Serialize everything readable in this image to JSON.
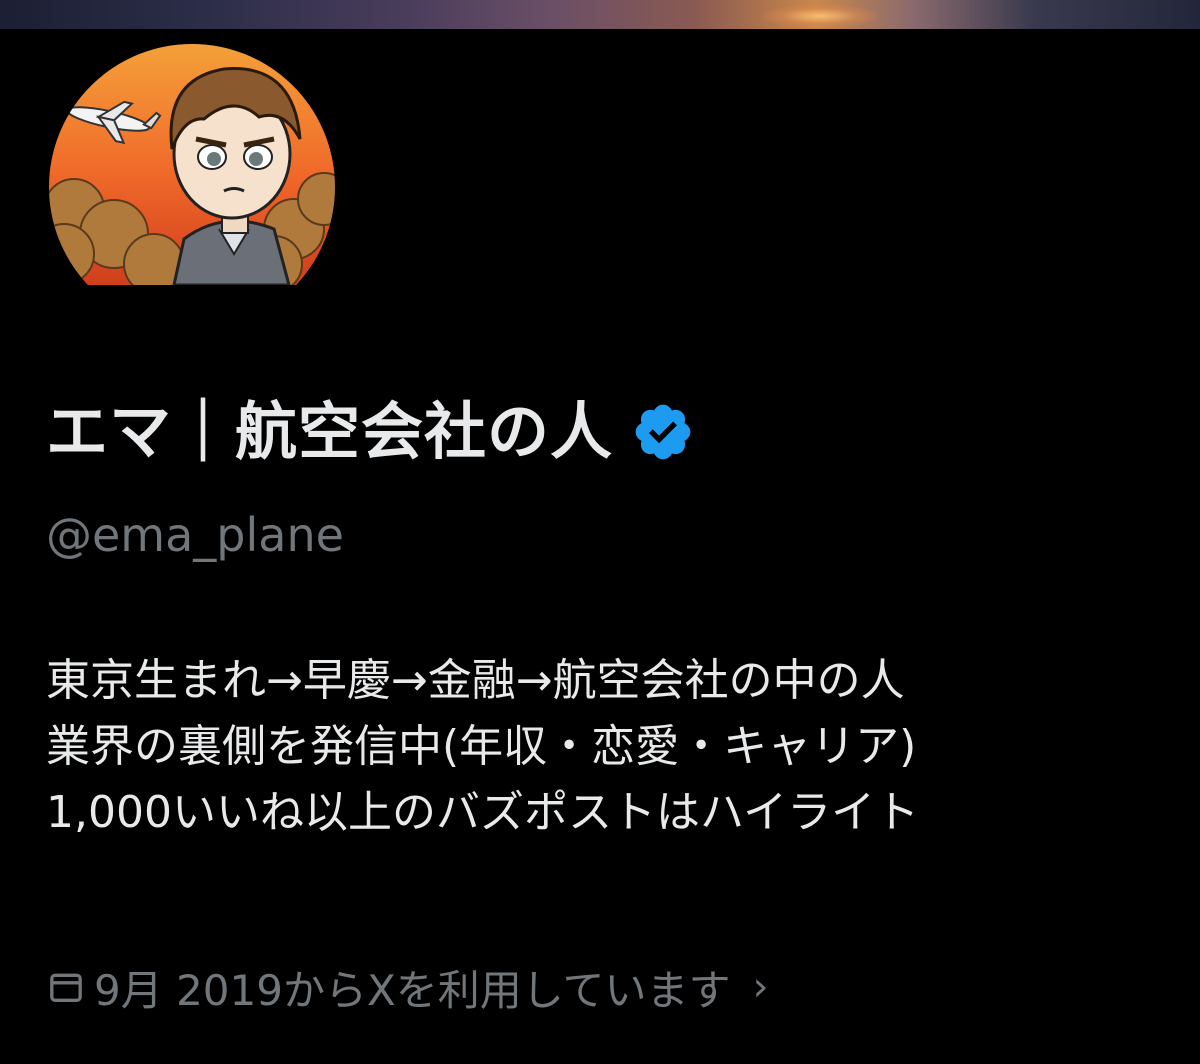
{
  "profile": {
    "display_name": "エマ｜航空会社の人",
    "handle": "@ema_plane",
    "verified": true,
    "verified_color": "#1d9bf0",
    "avatar_icon": "avatar-image",
    "bio_lines": [
      "東京生まれ→早慶→金融→航空会社の中の人",
      "業界の裏側を発信中(年収・恋愛・キャリア)",
      "1,000いいね以上のバズポストはハイライト"
    ],
    "joined_text": "9月 2019からXを利用しています",
    "joined_icon": "calendar-icon",
    "joined_chevron": "›"
  },
  "colors": {
    "background": "#000000",
    "primary_text": "#e7e9ea",
    "secondary_text": "#71767b",
    "accent": "#1d9bf0"
  }
}
